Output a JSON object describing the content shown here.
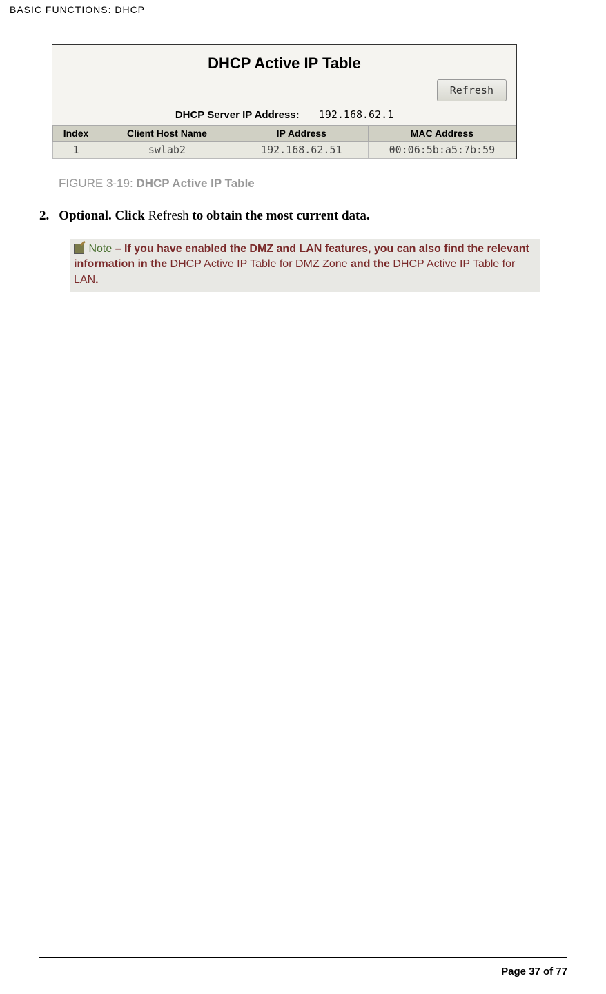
{
  "header": {
    "title": "BASIC FUNCTIONS: DHCP"
  },
  "figure": {
    "title": "DHCP Active IP Table",
    "refresh_label": "Refresh",
    "server_ip_label": "DHCP Server IP Address:",
    "server_ip_value": "192.168.62.1",
    "columns": {
      "index": "Index",
      "host": "Client Host Name",
      "ip": "IP Address",
      "mac": "MAC Address"
    },
    "rows": [
      {
        "index": "1",
        "host": "swlab2",
        "ip": "192.168.62.51",
        "mac": "00:06:5b:a5:7b:59"
      }
    ],
    "caption_prefix": "FIGURE 3-19: ",
    "caption_name": "DHCP Active IP Table"
  },
  "step": {
    "number": "2.",
    "bold1": "Optional. Click ",
    "plain": "Refresh",
    "bold2": " to obtain the most current data."
  },
  "note": {
    "label": "Note",
    "dash": " – ",
    "bold1": "If you have enabled the DMZ and LAN features, you can also find the relevant information in the ",
    "plain1": "DHCP Active IP Table for DMZ Zone",
    "bold2": " and the ",
    "plain2": "DHCP Active IP Table for LAN",
    "bold3": "."
  },
  "footer": {
    "page": "Page 37 of 77"
  }
}
